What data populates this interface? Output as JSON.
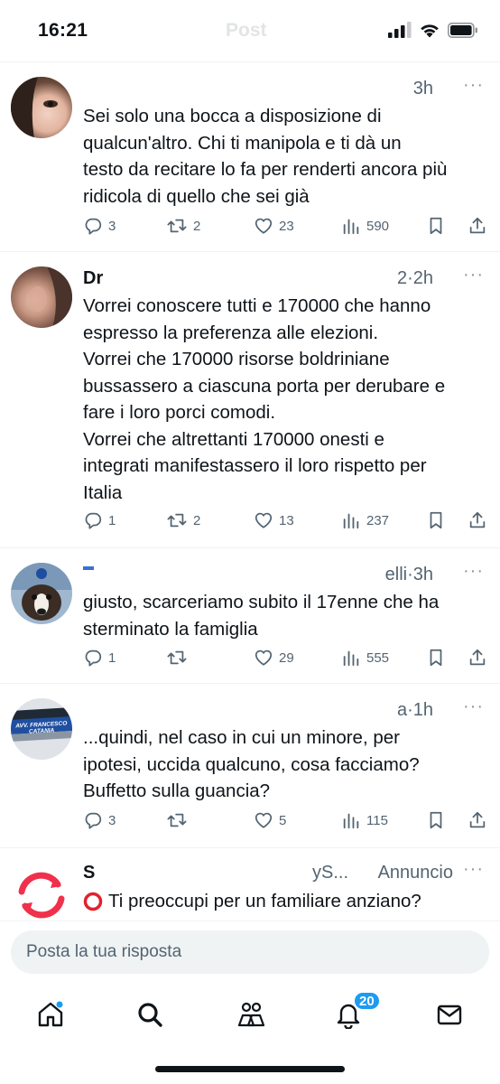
{
  "status_bar": {
    "time": "16:21",
    "ghost_title": "Post"
  },
  "tweets": [
    {
      "name": "",
      "meta": "3h",
      "more": "···",
      "text": [
        "Sei solo una bocca a disposizione di",
        "qualcun'altro. Chi ti manipola e ti dà un",
        "testo da recitare lo fa per renderti ancora più",
        "ridicola di quello che sei già"
      ],
      "replies": "3",
      "reposts": "2",
      "likes": "23",
      "views": "590"
    },
    {
      "name": "Dr",
      "meta": "2·2h",
      "more": "···",
      "text": [
        "Vorrei conoscere tutti e 170000 che hanno",
        "espresso la preferenza alle elezioni.",
        "Vorrei che 170000 risorse boldriniane",
        "bussassero a ciascuna porta per derubare e",
        "fare i loro porci comodi.",
        "Vorrei che altrettanti 170000 onesti e",
        "integrati manifestassero il loro rispetto per",
        "Italia"
      ],
      "replies": "1",
      "reposts": "2",
      "likes": "13",
      "views": "237"
    },
    {
      "name": "",
      "meta": "elli·3h",
      "more": "···",
      "text": [
        "giusto, scarceriamo subito il 17enne che ha",
        "sterminato la famiglia"
      ],
      "replies": "1",
      "reposts": "",
      "likes": "29",
      "views": "555"
    },
    {
      "name": "",
      "meta": "a·1h",
      "more": "···",
      "avatar_text": [
        "AVV. FRANCESCO",
        "CATANIA"
      ],
      "text": [
        "...quindi, nel caso in cui un minore, per",
        "ipotesi, uccida qualcuno, cosa facciamo?",
        "Buffetto sulla guancia?"
      ],
      "replies": "3",
      "reposts": "",
      "likes": "5",
      "views": "115"
    },
    {
      "name": "S",
      "meta": "yS...",
      "ad_label": "Annuncio",
      "more": "···",
      "text": [
        "Ti preoccupi per un familiare anziano?"
      ]
    }
  ],
  "reply_bar": {
    "placeholder": "Posta la tua risposta"
  },
  "tab_bar": {
    "icons": [
      "home-icon",
      "search-icon",
      "communities-icon",
      "notifications-icon",
      "messages-icon"
    ],
    "notification_count": "20"
  },
  "colors": {
    "accent": "#1d9bf0",
    "text": "#0f1419",
    "muted": "#536471",
    "ad_red": "#f0314b"
  }
}
